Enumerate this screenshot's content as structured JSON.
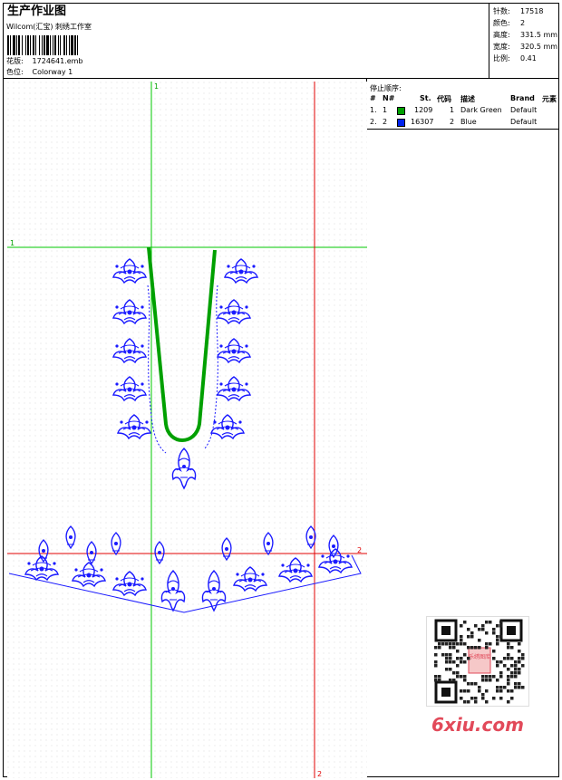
{
  "header": {
    "title": "生产作业图",
    "subtitle": "Wilcom(汇宝) 刺绣工作室",
    "design_label": "花版:",
    "design_file": "1724641.emb",
    "colorway_label": "色位:",
    "colorway": "Colorway 1"
  },
  "stats": [
    {
      "label": "针数:",
      "value": "17518"
    },
    {
      "label": "颜色:",
      "value": "2"
    },
    {
      "label": "高度:",
      "value": "331.5 mm"
    },
    {
      "label": "宽度:",
      "value": "320.5 mm"
    },
    {
      "label": "比例:",
      "value": "0.41"
    }
  ],
  "guides": {
    "green_top": "1",
    "green_left": "1",
    "red_right": "2",
    "red_bottom": "2"
  },
  "stop_sequence": {
    "title": "停止顺序:",
    "headers": [
      "#",
      "N#",
      "St.",
      "代码",
      "描述",
      "Brand",
      "元素"
    ],
    "rows": [
      {
        "idx": "1.",
        "n": "1",
        "color": "#00a000",
        "st": "1209",
        "code": "1",
        "desc": "Dark Green",
        "brand": "Default",
        "element": ""
      },
      {
        "idx": "2.",
        "n": "2",
        "color": "#0022ee",
        "st": "16307",
        "code": "2",
        "desc": "Blue",
        "brand": "Default",
        "element": ""
      }
    ]
  },
  "watermark": {
    "text": "6xiu.com",
    "qr_stamp": "乐绣图库"
  },
  "colors": {
    "guide_green": "#00c800",
    "guide_red": "#e00000",
    "embroidery_blue": "#1a1aff",
    "embroidery_green": "#00a000"
  }
}
